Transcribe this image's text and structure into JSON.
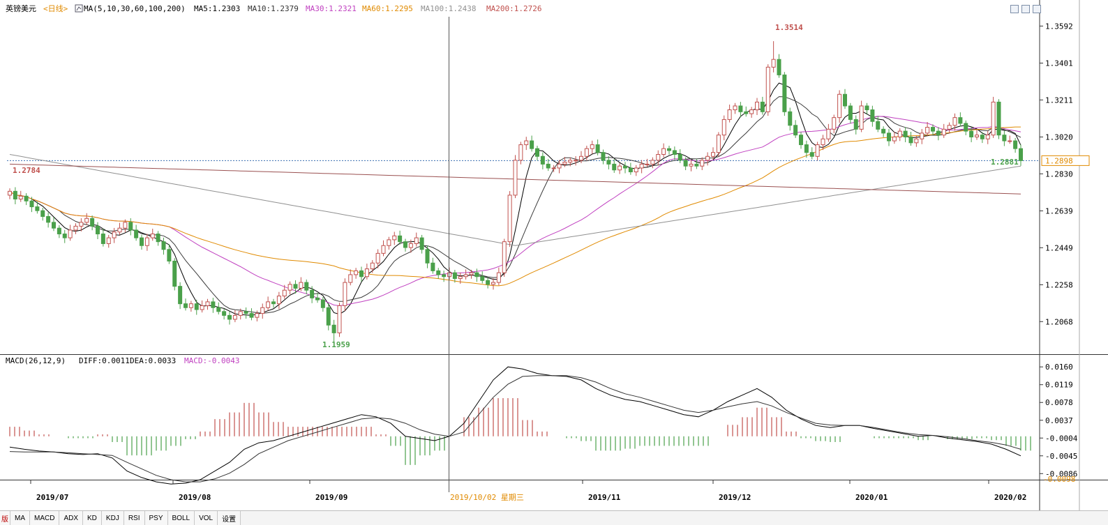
{
  "header": {
    "symbol": "英镑美元",
    "period": "<日线>",
    "ma_params": "MA(5,10,30,60,100,200)",
    "ma5": "MA5:1.2303",
    "ma10": "MA10:1.2379",
    "ma30": "MA30:1.2321",
    "ma60": "MA60:1.2295",
    "ma100": "MA100:1.2438",
    "ma200": "MA200:1.2726"
  },
  "colors": {
    "up": "#c0504d",
    "down": "#4aa04a",
    "ma5": "#000000",
    "ma10": "#3a3a3a",
    "ma30": "#c040c0",
    "ma60": "#e08a00",
    "ma100": "#909090",
    "ma200": "#9a5050",
    "last_price_line": "#3a6fb0",
    "macd_label": "#c040c0"
  },
  "price_axis": {
    "ticks": [
      "1.3592",
      "1.3401",
      "1.3211",
      "1.3020",
      "1.2830",
      "1.2639",
      "1.2449",
      "1.2258",
      "1.2068"
    ],
    "last_price": "1.2898"
  },
  "annotations": {
    "high": "1.3514",
    "low": "1.1959",
    "left_price": "1.2784",
    "recent_low": "1.2881"
  },
  "macd": {
    "label": "MACD(26,12,9)",
    "diff": "DIFF:0.0011",
    "dea": "DEA:0.0033",
    "macd": "MACD:-0.0043",
    "ticks": [
      "0.0160",
      "0.0119",
      "0.0078",
      "0.0037",
      "-0.0004",
      "-0.0045",
      "-0.0086"
    ],
    "current": "-0.0098"
  },
  "time_axis": {
    "labels": [
      "2019/07",
      "2019/08",
      "2019/09",
      "2019/11",
      "2019/12",
      "2020/01",
      "2020/02"
    ],
    "crosshair_label": "2019/10/02 星期三"
  },
  "bottom_tabs": {
    "edge": "版",
    "items": [
      "MA",
      "MACD",
      "ADX",
      "KD",
      "KDJ",
      "RSI",
      "PSY",
      "BOLL",
      "VOL",
      "设置"
    ]
  },
  "chart_data": {
    "type": "candlestick",
    "title": "英镑美元<日线>",
    "y_range": [
      1.19,
      1.364
    ],
    "highlighted_high": 1.3514,
    "highlighted_low": 1.1959,
    "last_price": 1.2898,
    "x_labels": [
      "2019/07",
      "2019/08",
      "2019/09",
      "2019/11",
      "2019/12",
      "2020/01",
      "2020/02"
    ],
    "series": [
      {
        "name": "MA5",
        "last": 1.2303
      },
      {
        "name": "MA10",
        "last": 1.2379
      },
      {
        "name": "MA30",
        "last": 1.2321
      },
      {
        "name": "MA60",
        "last": 1.2295
      },
      {
        "name": "MA100",
        "last": 1.2438
      },
      {
        "name": "MA200",
        "last": 1.2726
      }
    ],
    "close_path": [
      1.274,
      1.27,
      1.2715,
      1.269,
      1.266,
      1.264,
      1.261,
      1.258,
      1.255,
      1.252,
      1.25,
      1.254,
      1.256,
      1.258,
      1.26,
      1.256,
      1.252,
      1.247,
      1.25,
      1.253,
      1.255,
      1.258,
      1.254,
      1.25,
      1.246,
      1.25,
      1.252,
      1.248,
      1.244,
      1.238,
      1.225,
      1.216,
      1.214,
      1.216,
      1.213,
      1.215,
      1.217,
      1.214,
      1.212,
      1.21,
      1.208,
      1.21,
      1.212,
      1.211,
      1.209,
      1.211,
      1.214,
      1.217,
      1.216,
      1.22,
      1.223,
      1.226,
      1.224,
      1.227,
      1.223,
      1.219,
      1.218,
      1.214,
      1.205,
      1.201,
      1.215,
      1.227,
      1.231,
      1.233,
      1.23,
      1.234,
      1.237,
      1.242,
      1.246,
      1.249,
      1.251,
      1.248,
      1.245,
      1.247,
      1.25,
      1.244,
      1.237,
      1.233,
      1.231,
      1.23,
      1.232,
      1.229,
      1.23,
      1.231,
      1.232,
      1.23,
      1.228,
      1.226,
      1.227,
      1.232,
      1.248,
      1.272,
      1.29,
      1.298,
      1.3,
      1.296,
      1.292,
      1.288,
      1.286,
      1.286,
      1.288,
      1.289,
      1.29,
      1.29,
      1.292,
      1.296,
      1.298,
      1.294,
      1.29,
      1.288,
      1.285,
      1.287,
      1.286,
      1.284,
      1.286,
      1.288,
      1.288,
      1.29,
      1.293,
      1.296,
      1.295,
      1.293,
      1.29,
      1.287,
      1.288,
      1.287,
      1.29,
      1.292,
      1.294,
      1.303,
      1.311,
      1.316,
      1.318,
      1.315,
      1.314,
      1.316,
      1.32,
      1.315,
      1.338,
      1.342,
      1.334,
      1.315,
      1.308,
      1.303,
      1.298,
      1.294,
      1.292,
      1.298,
      1.301,
      1.306,
      1.312,
      1.324,
      1.318,
      1.311,
      1.306,
      1.318,
      1.316,
      1.31,
      1.306,
      1.304,
      1.3,
      1.302,
      1.305,
      1.302,
      1.299,
      1.301,
      1.304,
      1.307,
      1.305,
      1.303,
      1.306,
      1.308,
      1.312,
      1.309,
      1.305,
      1.302,
      1.303,
      1.301,
      1.303,
      1.32,
      1.303,
      1.3,
      1.3,
      1.296,
      1.2898
    ],
    "macd_diff": [
      -0.0025,
      -0.003,
      -0.0034,
      -0.0036,
      -0.004,
      -0.0042,
      -0.004,
      -0.005,
      -0.008,
      -0.0095,
      -0.0105,
      -0.011,
      -0.0108,
      -0.01,
      -0.008,
      -0.006,
      -0.003,
      -0.0015,
      -0.001,
      0.0,
      0.001,
      0.002,
      0.003,
      0.004,
      0.005,
      0.0045,
      0.003,
      0.0,
      -0.0005,
      -0.001,
      0.0,
      0.003,
      0.008,
      0.013,
      0.016,
      0.0155,
      0.0145,
      0.014,
      0.0138,
      0.013,
      0.011,
      0.0095,
      0.0085,
      0.008,
      0.007,
      0.006,
      0.005,
      0.0045,
      0.006,
      0.008,
      0.0095,
      0.011,
      0.009,
      0.006,
      0.004,
      0.0025,
      0.002,
      0.0025,
      0.0025,
      0.0018,
      0.0012,
      0.0006,
      0.0,
      0.0002,
      -0.0004,
      -0.0008,
      -0.0012,
      -0.0018,
      -0.003,
      -0.0045
    ],
    "macd_dea": [
      -0.0035,
      -0.0036,
      -0.0036,
      -0.0036,
      -0.0038,
      -0.004,
      -0.0042,
      -0.0044,
      -0.006,
      -0.0075,
      -0.009,
      -0.01,
      -0.0105,
      -0.0105,
      -0.0098,
      -0.0085,
      -0.0065,
      -0.004,
      -0.0025,
      -0.001,
      0.0,
      0.001,
      0.002,
      0.003,
      0.004,
      0.0043,
      0.004,
      0.003,
      0.0015,
      0.0005,
      0.0,
      0.001,
      0.005,
      0.009,
      0.012,
      0.0138,
      0.014,
      0.014,
      0.014,
      0.0135,
      0.0125,
      0.011,
      0.0098,
      0.009,
      0.008,
      0.007,
      0.006,
      0.0055,
      0.006,
      0.0068,
      0.0075,
      0.008,
      0.007,
      0.0055,
      0.0042,
      0.003,
      0.0026,
      0.0025,
      0.0025,
      0.002,
      0.0014,
      0.0008,
      0.0004,
      0.0002,
      -0.0001,
      -0.0005,
      -0.001,
      -0.0014,
      -0.002,
      -0.003
    ]
  }
}
